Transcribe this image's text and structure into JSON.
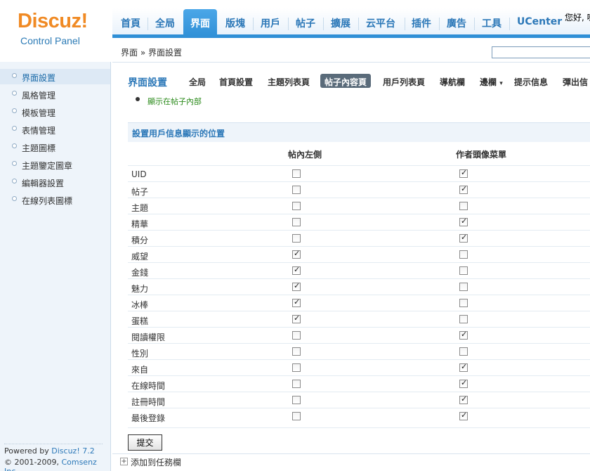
{
  "logo": {
    "title": "Discuz!",
    "subtitle": "Control Panel"
  },
  "topnav": {
    "items": [
      "首頁",
      "全局",
      "界面",
      "版塊",
      "用戶",
      "帖子",
      "擴展",
      "云平台",
      "插件",
      "廣告",
      "工具",
      "UCenter"
    ],
    "active": "界面",
    "greeting": "您好, 喇"
  },
  "breadcrumb": "界面 » 界面設置",
  "sidebar": {
    "items": [
      "界面設置",
      "風格管理",
      "模板管理",
      "表情管理",
      "主題圖標",
      "主題鑒定圖章",
      "編輯器設置",
      "在線列表圖標"
    ],
    "active": "界面設置",
    "powered_prefix": "Powered by ",
    "powered_link": "Discuz! 7.2",
    "copyright_prefix": "© 2001-2009, ",
    "copyright_link": "Comsenz Inc."
  },
  "subtabs": {
    "title": "界面設置",
    "items": [
      "全局",
      "首頁設置",
      "主題列表頁",
      "帖子內容頁",
      "用戶列表頁",
      "導航欄",
      "邊欄",
      "提示信息",
      "彈出信"
    ],
    "active": "帖子內容頁",
    "dropdown_caret": "▾"
  },
  "tip": "顯示在帖子內部",
  "section": {
    "title": "設置用戶信息顯示的位置",
    "col_left": "帖內左側",
    "col_menu": "作者頭像菜單",
    "rows": [
      {
        "label": "UID",
        "left": false,
        "menu": true
      },
      {
        "label": "帖子",
        "left": false,
        "menu": true
      },
      {
        "label": "主題",
        "left": false,
        "menu": false
      },
      {
        "label": "精華",
        "left": false,
        "menu": true
      },
      {
        "label": "積分",
        "left": false,
        "menu": true
      },
      {
        "label": "威望",
        "left": true,
        "menu": false
      },
      {
        "label": "金錢",
        "left": true,
        "menu": false
      },
      {
        "label": "魅力",
        "left": true,
        "menu": false
      },
      {
        "label": "冰棒",
        "left": true,
        "menu": false
      },
      {
        "label": "蛋糕",
        "left": true,
        "menu": false
      },
      {
        "label": "閱讀權限",
        "left": false,
        "menu": true
      },
      {
        "label": "性別",
        "left": false,
        "menu": false
      },
      {
        "label": "來自",
        "left": false,
        "menu": true
      },
      {
        "label": "在線時間",
        "left": false,
        "menu": true
      },
      {
        "label": "註冊時間",
        "left": false,
        "menu": true
      },
      {
        "label": "最後登錄",
        "left": false,
        "menu": true
      }
    ]
  },
  "submit_label": "提交",
  "add_task": "添加到任務欄"
}
